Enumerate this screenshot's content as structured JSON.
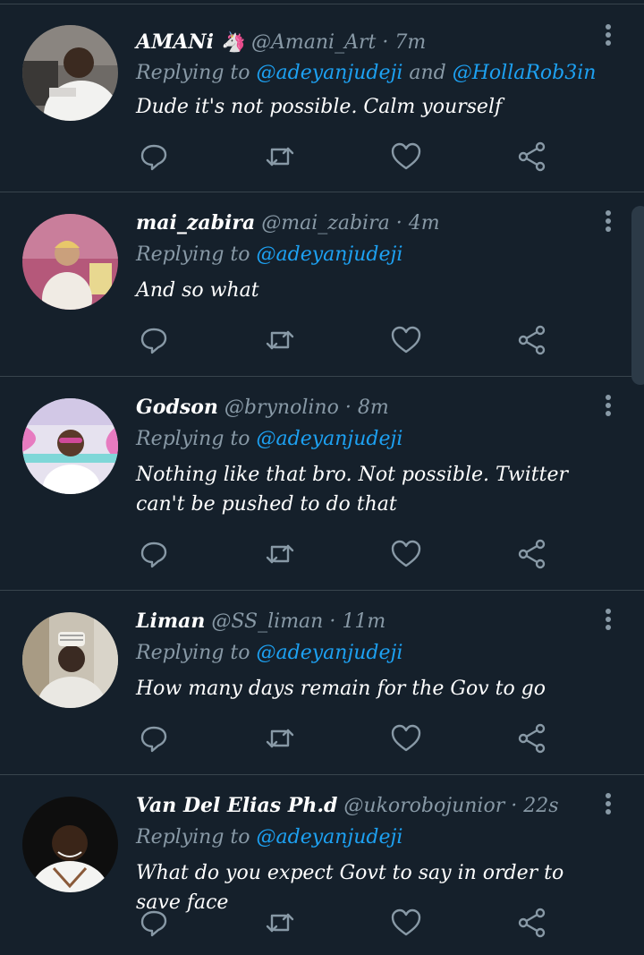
{
  "tweets": [
    {
      "name": "AMANi 🦄",
      "handle": "@Amani_Art",
      "dot": "·",
      "time": "7m",
      "replying_prefix": "Replying to ",
      "mention_1": "@adeyanjudeji",
      "mention_join": " and ",
      "mention_2": "@HollaRob3in",
      "text": "Dude it's not possible. Calm yourself"
    },
    {
      "name": "mai_zabira",
      "handle": "@mai_zabira",
      "dot": "·",
      "time": "4m",
      "replying_prefix": "Replying to ",
      "mention_1": "@adeyanjudeji",
      "text": "And so what"
    },
    {
      "name": "Godson",
      "handle": "@brynolino",
      "dot": "·",
      "time": "8m",
      "replying_prefix": "Replying to ",
      "mention_1": "@adeyanjudeji",
      "text": "Nothing like that bro. Not possible. Twitter can't be pushed to do that"
    },
    {
      "name": "Liman",
      "handle": "@SS_liman",
      "dot": "·",
      "time": "11m",
      "replying_prefix": "Replying to ",
      "mention_1": "@adeyanjudeji",
      "text": "How many days remain for the Gov to go"
    },
    {
      "name": "Van Del Elias Ph.d",
      "handle": "@ukorobojunior",
      "dot": "·",
      "time": "22s",
      "replying_prefix": "Replying to ",
      "mention_1": "@adeyanjudeji",
      "text": "What do you expect Govt to say in order to save face"
    }
  ],
  "icons": {
    "reply": "reply-icon",
    "retweet": "retweet-icon",
    "like": "like-icon",
    "share": "share-icon",
    "more": "more-icon"
  },
  "colors": {
    "background": "#15202b",
    "divider": "#38444d",
    "secondary_text": "#8899a6",
    "link": "#1da1f2",
    "icon": "#8899a6"
  }
}
